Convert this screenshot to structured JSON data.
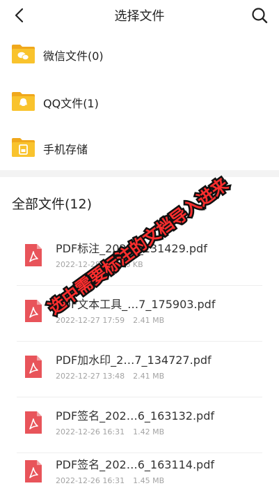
{
  "header": {
    "title": "选择文件",
    "back_icon": "chevron-left-icon",
    "search_icon": "search-icon"
  },
  "folders": [
    {
      "label": "微信文件(0)",
      "icon": "wechat-folder-icon"
    },
    {
      "label": "QQ文件(1)",
      "icon": "qq-folder-icon"
    },
    {
      "label": "手机存储",
      "icon": "phone-storage-folder-icon"
    }
  ],
  "section": {
    "title": "全部文件(12)"
  },
  "files": [
    {
      "name": "PDF标注_202…_131429.pdf",
      "date": "2022-12-28",
      "size": "80.96 KB"
    },
    {
      "name": "PDF文本工具_…7_175903.pdf",
      "date": "2022-12-27 17:59",
      "size": "2.41 MB"
    },
    {
      "name": "PDF加水印_2…7_134727.pdf",
      "date": "2022-12-27 13:48",
      "size": "2.41 MB"
    },
    {
      "name": "PDF签名_202…6_163132.pdf",
      "date": "2022-12-26 16:31",
      "size": "1.42 MB"
    },
    {
      "name": "PDF签名_202…6_163114.pdf",
      "date": "2022-12-26 16:31",
      "size": "1.45 MB"
    }
  ],
  "overlay_text": "选中需要标注的文档导入进来",
  "colors": {
    "folder": "#f9c32d",
    "folder_tab": "#f0a81c",
    "pdf": "#e8545a",
    "overlay": "#ff2e2e"
  }
}
